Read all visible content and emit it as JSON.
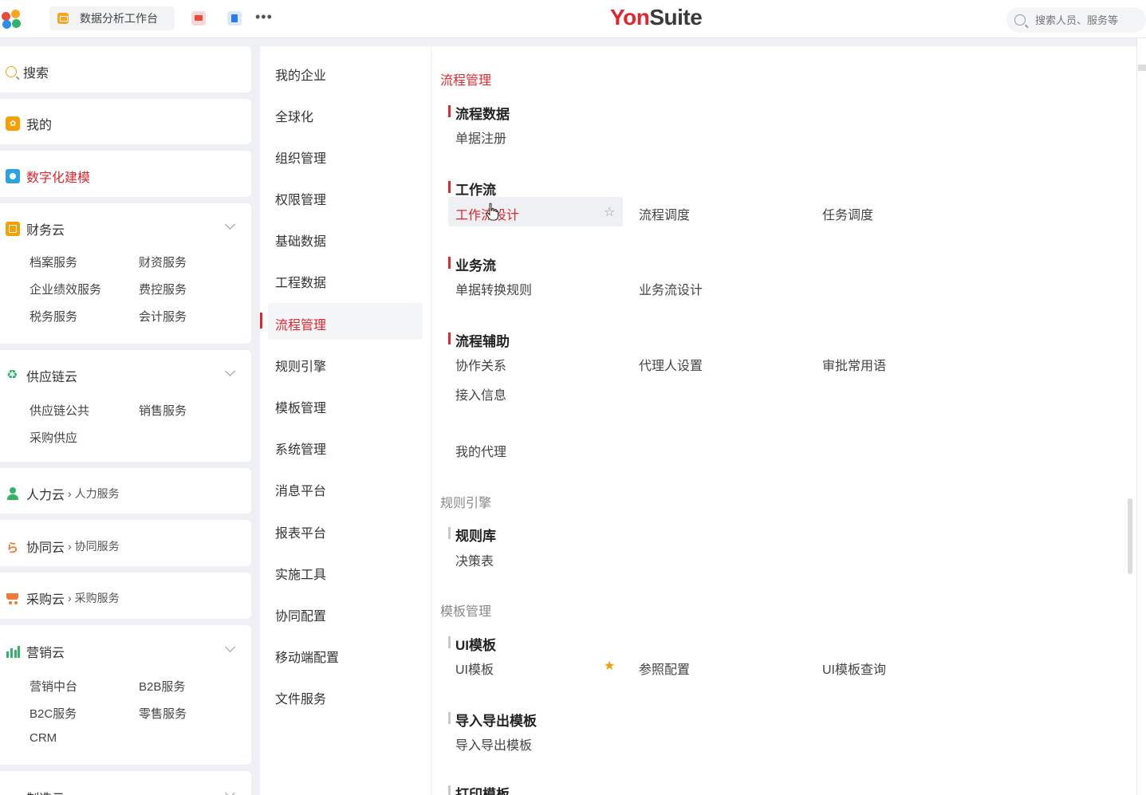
{
  "topbar": {
    "tab_label": "数据分析工作台",
    "more": "•••",
    "brand_red": "Yon",
    "brand_dark": "Suite",
    "search_placeholder": "搜索人员、服务等"
  },
  "left": {
    "search": "搜索",
    "mine": "我的",
    "digital": "数字化建模",
    "finance": {
      "title": "财务云",
      "items": [
        "档案服务",
        "财资服务",
        "企业绩效服务",
        "费控服务",
        "税务服务",
        "会计服务"
      ]
    },
    "supply": {
      "title": "供应链云",
      "items": [
        "供应链公共",
        "销售服务",
        "采购供应"
      ]
    },
    "hr": {
      "title": "人力云",
      "crumb": "› 人力服务"
    },
    "collab": {
      "title": "协同云",
      "crumb": "› 协同服务"
    },
    "procure": {
      "title": "采购云",
      "crumb": "› 采购服务"
    },
    "marketing": {
      "title": "营销云",
      "items": [
        "营销中台",
        "B2B服务",
        "B2C服务",
        "零售服务",
        "CRM"
      ]
    },
    "manufacture": {
      "title": "制造云"
    }
  },
  "mid": {
    "items": [
      "我的企业",
      "全球化",
      "组织管理",
      "权限管理",
      "基础数据",
      "工程数据",
      "流程管理",
      "规则引擎",
      "模板管理",
      "系统管理",
      "消息平台",
      "报表平台",
      "实施工具",
      "协同配置",
      "移动端配置",
      "文件服务"
    ],
    "active_index": 6
  },
  "right": {
    "sections": [
      {
        "title": "流程管理",
        "active": true
      },
      {
        "title": "规则引擎",
        "active": false
      },
      {
        "title": "模板管理",
        "active": false
      }
    ],
    "groups": {
      "process_data": {
        "title": "流程数据",
        "links": [
          "单据注册"
        ]
      },
      "workflow": {
        "title": "工作流",
        "links": [
          "工作流设计",
          "流程调度",
          "任务调度"
        ]
      },
      "bizflow": {
        "title": "业务流",
        "links": [
          "单据转换规则",
          "业务流设计"
        ]
      },
      "process_aux": {
        "title": "流程辅助",
        "links": [
          "协作关系",
          "代理人设置",
          "审批常用语",
          "接入信息",
          "我的代理"
        ]
      },
      "rule_lib": {
        "title": "规则库",
        "links": [
          "决策表"
        ]
      },
      "ui_tpl": {
        "title": "UI模板",
        "links": [
          "UI模板",
          "参照配置",
          "UI模板查询"
        ]
      },
      "io_tpl": {
        "title": "导入导出模板",
        "links": [
          "导入导出模板"
        ]
      },
      "print_tpl": {
        "title": "打印模板"
      }
    }
  },
  "colors": {
    "accent": "#e0262e",
    "favorite": "#f5a000"
  }
}
